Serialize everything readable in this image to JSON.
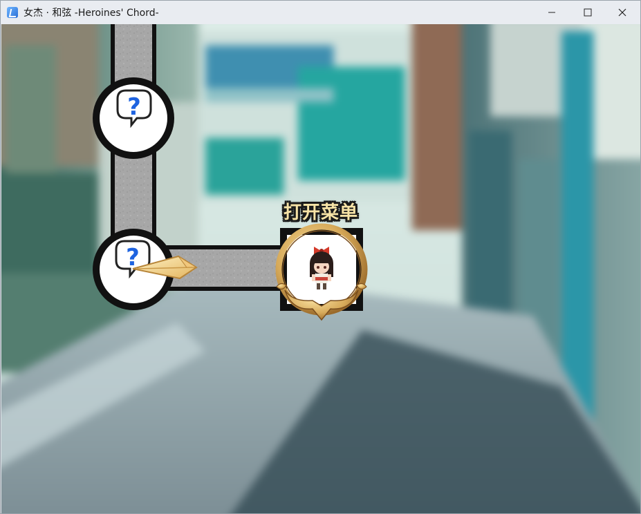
{
  "window": {
    "title": "女杰 · 和弦 -Heroines' Chord-"
  },
  "window_controls": {
    "minimize_icon": "minimize-icon",
    "maximize_icon": "maximize-icon",
    "close_icon": "close-icon"
  },
  "route_map": {
    "nodes": [
      {
        "kind": "unknown-event",
        "icon": "question-bubble-icon"
      },
      {
        "kind": "unknown-event",
        "icon": "question-bubble-icon"
      },
      {
        "kind": "menu",
        "icon": "character-portrait-icon"
      }
    ],
    "cursor_icon": "pointer-arrow-icon",
    "menu_label": "打开菜单"
  },
  "colors": {
    "path_border": "#111111",
    "path_fill": "#a9a9a9",
    "question_mark": "#1e63e0",
    "frame_gold": "#d7aa5a",
    "label_text": "#f7e3a6"
  }
}
